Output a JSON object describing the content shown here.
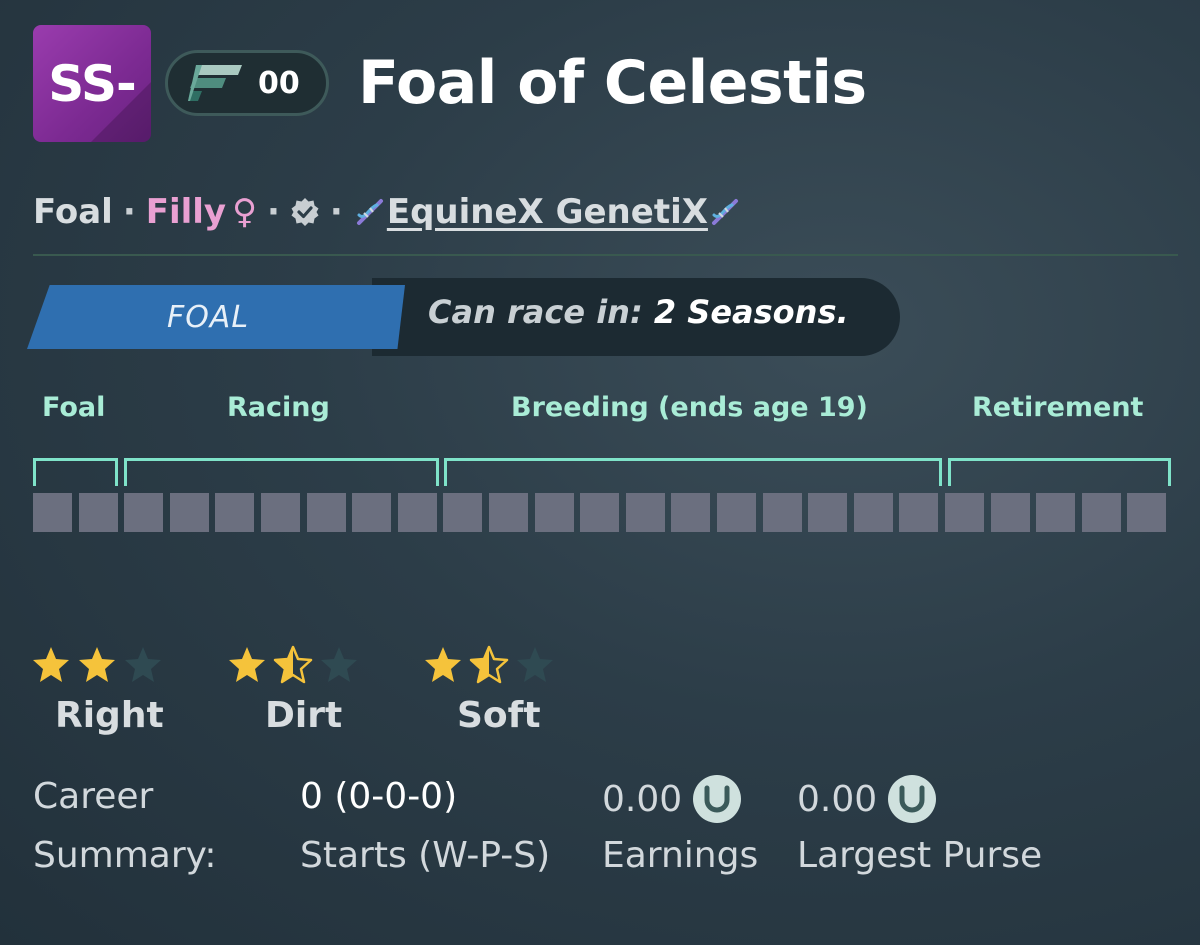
{
  "header": {
    "grade": "SS-",
    "generation": "00",
    "name": "Foal of Celestis"
  },
  "meta": {
    "age_class": "Foal",
    "sex": "Filly",
    "sex_symbol": "♀",
    "separator": "·",
    "stable": "EquineX GenetiX"
  },
  "stage": {
    "tag": "FOAL",
    "race_in_prefix": "Can race in:",
    "race_in_value": "2 Seasons."
  },
  "lifecycle": {
    "phases": [
      "Foal",
      "Racing",
      "Breeding (ends age 19)",
      "Retirement"
    ],
    "season_count": 25
  },
  "ratings": [
    {
      "label": "Right",
      "stars": 2,
      "max": 3
    },
    {
      "label": "Dirt",
      "stars": 1.5,
      "max": 3
    },
    {
      "label": "Soft",
      "stars": 1.5,
      "max": 3
    }
  ],
  "career": {
    "heading_line1": "Career",
    "heading_line2": "Summary:",
    "starts_value": "0 (0-0-0)",
    "starts_label": "Starts (W-P-S)",
    "earnings_value": "0.00",
    "earnings_label": "Earnings",
    "purse_value": "0.00",
    "purse_label": "Largest Purse"
  },
  "colors": {
    "grade_badge": "#8a33a0",
    "stage_tag": "#2f6fb0",
    "phase_label": "#a9ecd6",
    "star_filled": "#f5c33b",
    "star_empty": "#2f4a52",
    "season_block": "#6b6f7f",
    "filly": "#e9a0d2"
  },
  "icons": {
    "generation": "speed-flag-icon",
    "verified": "verified-badge-icon",
    "dna": "dna-icon",
    "currency": "coin-icon"
  }
}
